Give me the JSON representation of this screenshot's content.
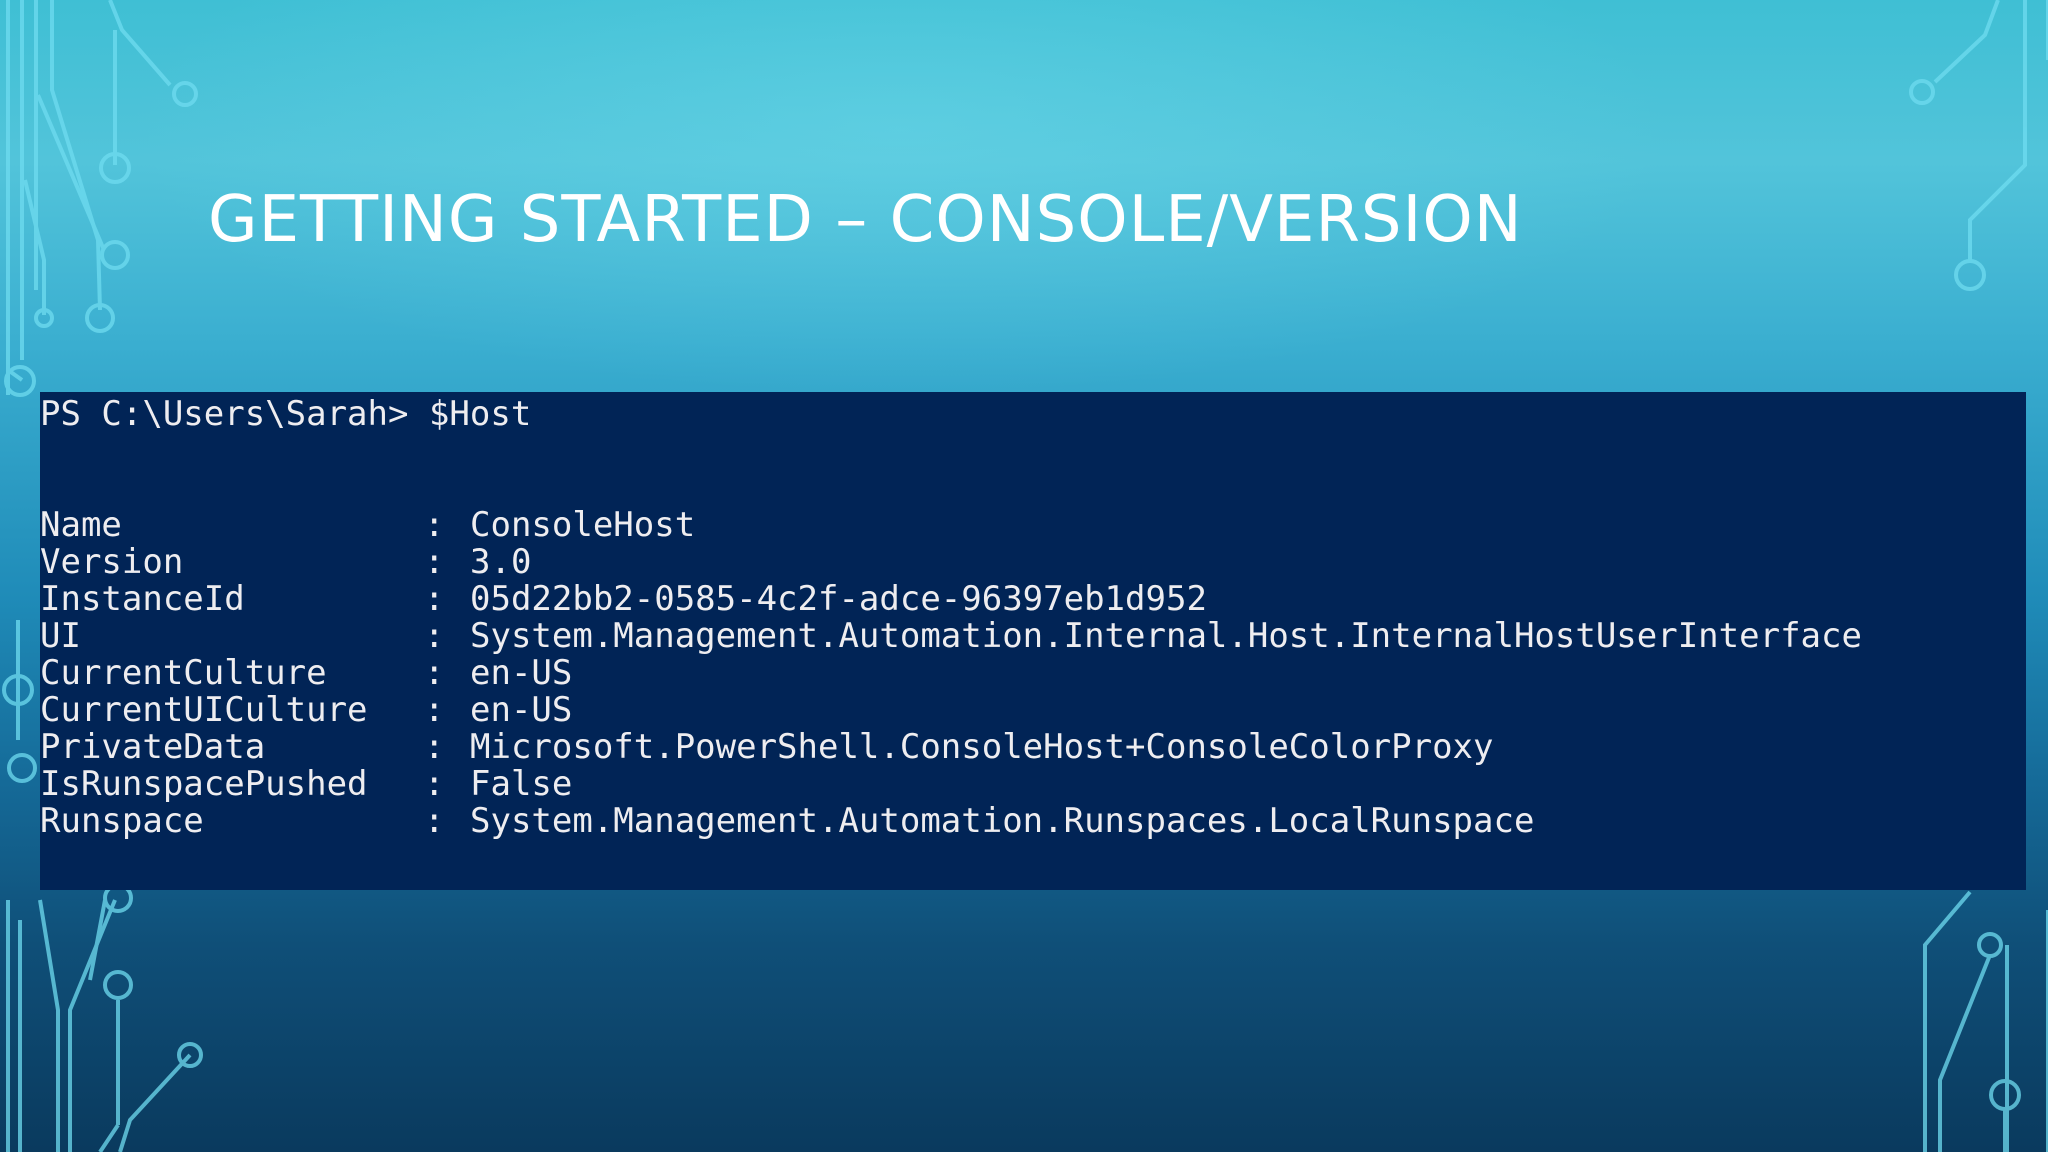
{
  "slide": {
    "title": "GETTING STARTED – CONSOLE/VERSION"
  },
  "console": {
    "prompt": "PS C:\\Users\\Sarah>",
    "command": "$Host",
    "separator": ":",
    "properties": [
      {
        "name": "Name",
        "value": "ConsoleHost"
      },
      {
        "name": "Version",
        "value": "3.0"
      },
      {
        "name": "InstanceId",
        "value": "05d22bb2-0585-4c2f-adce-96397eb1d952"
      },
      {
        "name": "UI",
        "value": "System.Management.Automation.Internal.Host.InternalHostUserInterface"
      },
      {
        "name": "CurrentCulture",
        "value": "en-US"
      },
      {
        "name": "CurrentUICulture",
        "value": "en-US"
      },
      {
        "name": "PrivateData",
        "value": "Microsoft.PowerShell.ConsoleHost+ConsoleColorProxy"
      },
      {
        "name": "IsRunspacePushed",
        "value": "False"
      },
      {
        "name": "Runspace",
        "value": "System.Management.Automation.Runspaces.LocalRunspace"
      }
    ]
  },
  "colors": {
    "console_background": "#012456",
    "console_text": "#eeedf0",
    "title_text": "#ffffff",
    "circuit_lines": "#5fd6ee"
  },
  "decorations": {
    "left_circuit_icon": "circuit-trace-icon",
    "right_circuit_icon": "circuit-trace-icon"
  }
}
